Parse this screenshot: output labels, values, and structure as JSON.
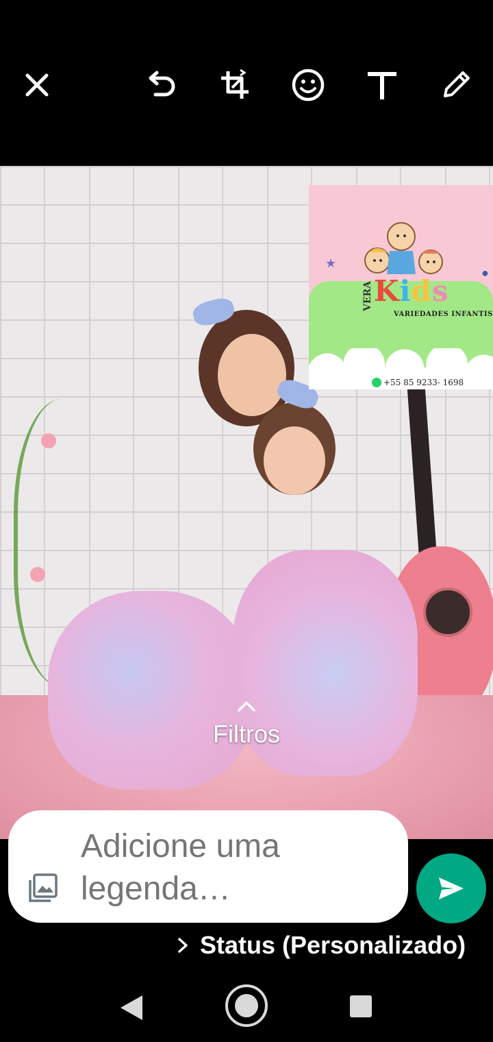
{
  "toolbar": {
    "icons": [
      "close-icon",
      "undo-icon",
      "crop-rotate-icon",
      "emoji-icon",
      "text-icon",
      "pencil-icon"
    ]
  },
  "image": {
    "logo": {
      "brand_prefix": "VERA",
      "brand_letters": [
        "K",
        "i",
        "d",
        "s"
      ],
      "subtitle": "VARIEDADES INFANTIS",
      "phone": "+55 85 9233- 1698"
    }
  },
  "filters": {
    "label": "Filtros"
  },
  "caption": {
    "placeholder": "Adicione uma legenda…"
  },
  "status": {
    "label": "Status (Personalizado)"
  },
  "colors": {
    "accent": "#00a884",
    "background": "#000000",
    "caption_bg": "#ffffff",
    "placeholder": "#6b7780"
  }
}
